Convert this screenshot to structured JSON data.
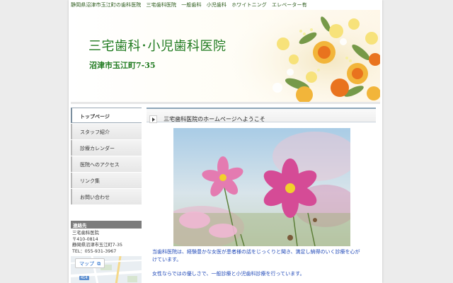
{
  "top_bar": {
    "text": "静岡県沼津市玉江町の歯科医院　三宅歯科医院　一般歯科　小児歯科　ホワイトニング　エレベーター有"
  },
  "header": {
    "clinic_name": "三宅歯科･小児歯科医院",
    "address": "沼津市玉江町7-35"
  },
  "sidebar": {
    "nav": [
      {
        "label": "トップページ",
        "active": true
      },
      {
        "label": "スタッフ紹介"
      },
      {
        "label": "診療カレンダー"
      },
      {
        "label": "医院へのアクセス"
      },
      {
        "label": "リンク集"
      },
      {
        "label": "お問い合わせ"
      }
    ],
    "contact": {
      "heading": "連絡先",
      "name": "三宅歯科医院",
      "postal": "〒410-0814",
      "address": "静岡県沼津市玉江町7-35",
      "tel": "TEL：055-931-3967"
    },
    "map": {
      "button_label": "マップ",
      "road_label": "414"
    }
  },
  "main": {
    "title": "三宅歯科医院のホームページへようこそ",
    "intro": [
      "当歯科医院は、経験豊かな女医が患者様の話をじっくりと聞き、満足し納得のいく診療を心がけています。",
      "女性ならではの優しさで、一般診療と小児歯科診療を行っています。"
    ]
  },
  "colors": {
    "accent_green": "#1f7a1f",
    "intro_blue": "#2049b8",
    "nav_active_border": "#7b8e9e"
  }
}
